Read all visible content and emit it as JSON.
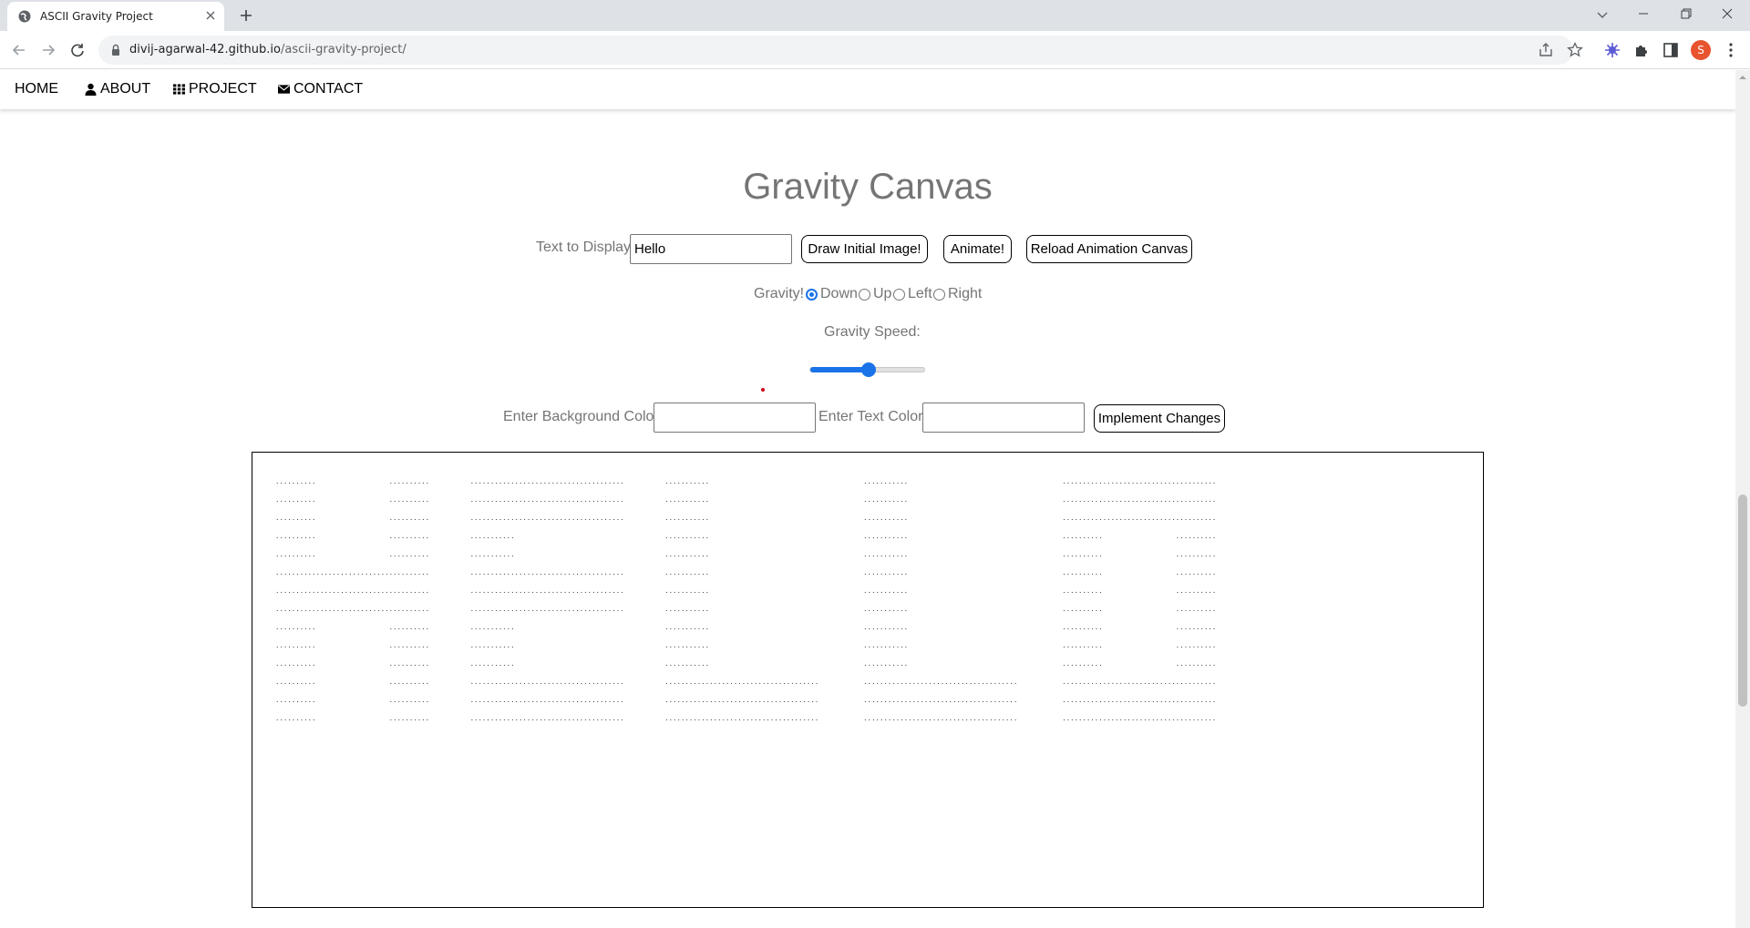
{
  "browser": {
    "tab_title": "ASCII Gravity Project",
    "url_host": "divij-agarwal-42.github.io",
    "url_path": "/ascii-gravity-project/",
    "profile_initial": "S"
  },
  "nav": {
    "home": "HOME",
    "about": "ABOUT",
    "project": "PROJECT",
    "contact": "CONTACT"
  },
  "page": {
    "title": "Gravity Canvas",
    "text_label": "Text to Display:",
    "text_value": "Hello",
    "draw_button": "Draw Initial Image!",
    "animate_button": "Animate!",
    "reload_button": "Reload Animation Canvas",
    "gravity_label": "Gravity!",
    "gravity_options": [
      "Down",
      "Up",
      "Left",
      "Right"
    ],
    "gravity_selected": "Down",
    "speed_label": "Gravity Speed:",
    "speed_fraction": 0.5,
    "bg_color_label": "Enter Background Color:",
    "text_color_label": "Enter Text Color:",
    "implement_button": "Implement Changes"
  },
  "canvas": {
    "ascii_lines": [
      "..........                  ..........          ......................................          ...........                                      ...........                                      ......................................",
      "..........                  ..........          ......................................          ...........                                      ...........                                      ......................................",
      "..........                  ..........          ......................................          ...........                                      ...........                                      ......................................",
      "..........                  ..........          ...........                                     ...........                                      ...........                                      ..........                  ..........",
      "..........                  ..........          ...........                                     ...........                                      ...........                                      ..........                  ..........",
      "......................................          ......................................          ...........                                      ...........                                      ..........                  ..........",
      "......................................          ......................................          ...........                                      ...........                                      ..........                  ..........",
      "......................................          ......................................          ...........                                      ...........                                      ..........                  ..........",
      "..........                  ..........          ...........                                     ...........                                      ...........                                      ..........                  ..........",
      "..........                  ..........          ...........                                     ...........                                      ...........                                      ..........                  ..........",
      "..........                  ..........          ...........                                     ...........                                      ...........                                      ..........                  ..........",
      "..........                  ..........          ......................................          ......................................           ......................................           ......................................",
      "..........                  ..........          ......................................          ......................................           ......................................           ......................................",
      "..........                  ..........          ......................................          ......................................           ......................................           ......................................"
    ]
  }
}
